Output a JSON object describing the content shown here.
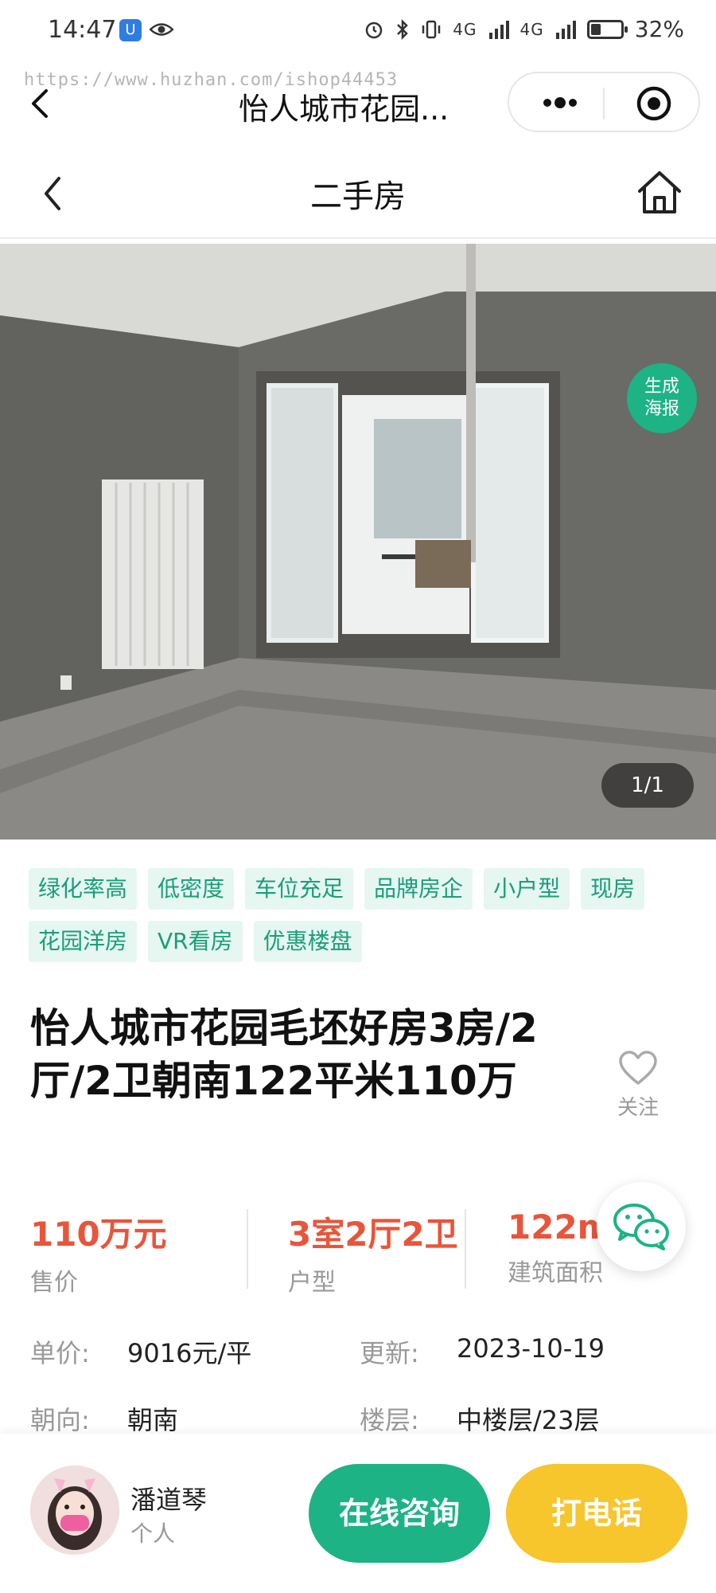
{
  "status_bar": {
    "time": "14:47",
    "battery": "32%",
    "battery_level": 0.32,
    "network_1": "4G",
    "network_2": "4G"
  },
  "watermark": "https://www.huzhan.com/ishop44453",
  "miniprogram": {
    "title": "怡人城市花园..."
  },
  "nav": {
    "title": "二手房"
  },
  "photo": {
    "poster_label": "生成海报",
    "counter": "1/1"
  },
  "tags": [
    "绿化率高",
    "低密度",
    "车位充足",
    "品牌房企",
    "小户型",
    "现房",
    "花园洋房",
    "VR看房",
    "优惠楼盘"
  ],
  "listing": {
    "title": "怡人城市花园毛坯好房3房/2厅/2卫朝南122平米110万",
    "favorite_label": "关注"
  },
  "stats": [
    {
      "value": "110万元",
      "label": "售价"
    },
    {
      "value": "3室2厅2卫",
      "label": "户型"
    },
    {
      "value": "122m",
      "label": "建筑面积"
    }
  ],
  "info": {
    "unit_price_label": "单价:",
    "unit_price": "9016元/平",
    "updated_label": "更新:",
    "updated": "2023-10-19",
    "orientation_label": "朝向:",
    "orientation": "朝南",
    "floor_label": "楼层:",
    "floor": "中楼层/23层"
  },
  "agent": {
    "name": "潘道琴",
    "role": "个人"
  },
  "actions": {
    "consult": "在线咨询",
    "call": "打电话"
  },
  "colors": {
    "accent_green": "#1db385",
    "price_red": "#e8553b",
    "call_yellow": "#f7c52c",
    "tag_bg": "#e6f6f1",
    "tag_text": "#1a9e78"
  }
}
